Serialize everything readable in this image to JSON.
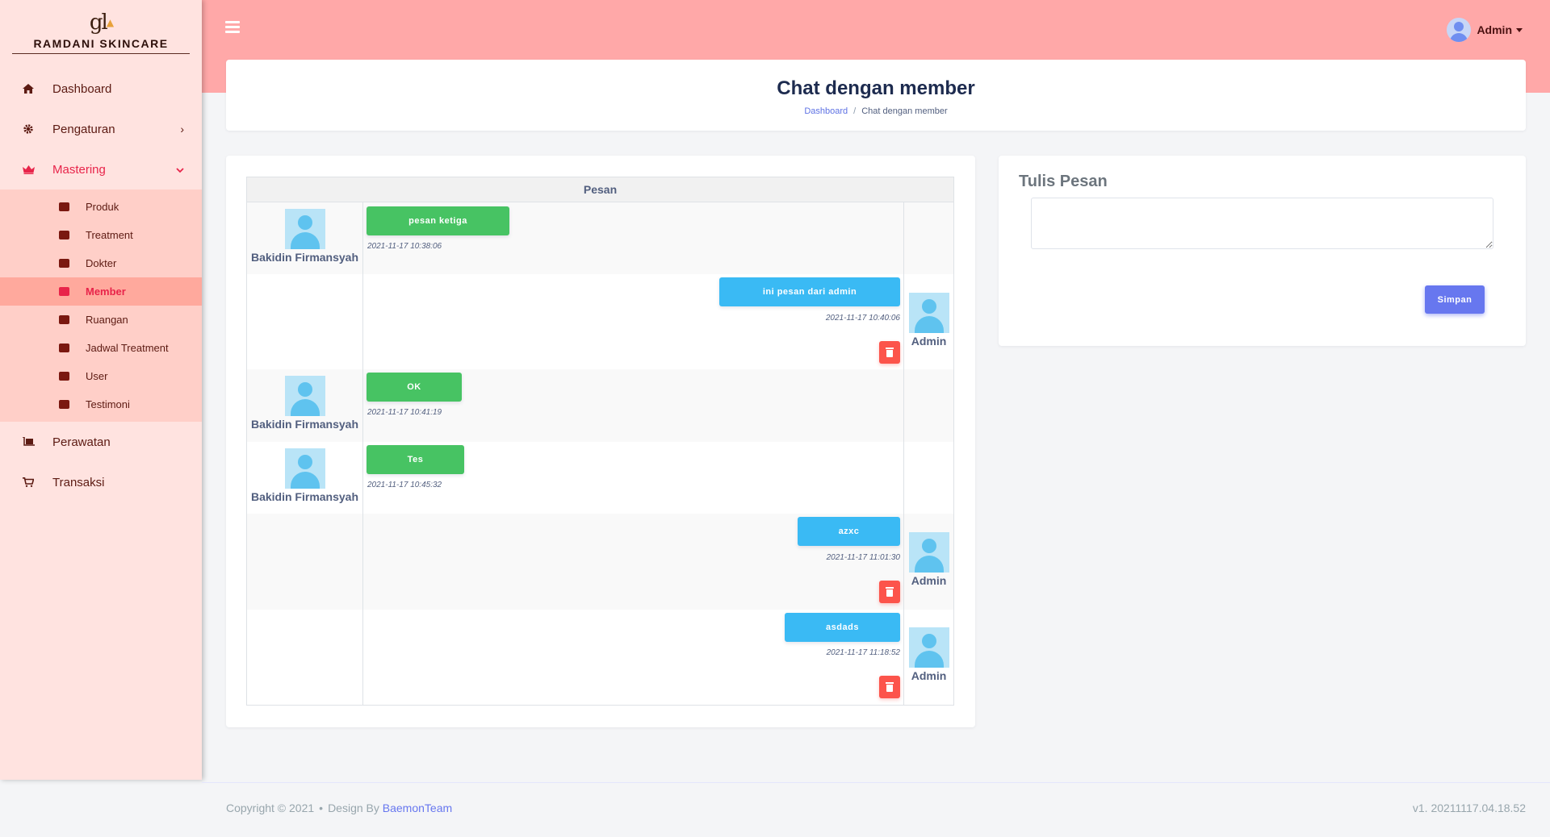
{
  "brand": {
    "logo_text": "gl",
    "name": "RAMDANI SKINCARE"
  },
  "header": {
    "user_name": "Admin"
  },
  "sidebar": {
    "items": [
      {
        "label": "Dashboard",
        "icon": "home-icon"
      },
      {
        "label": "Pengaturan",
        "icon": "cog-icon"
      },
      {
        "label": "Mastering",
        "icon": "crown-icon"
      },
      {
        "label": "Perawatan",
        "icon": "luggage-cart-icon"
      },
      {
        "label": "Transaksi",
        "icon": "cart-icon"
      }
    ],
    "submenu": [
      {
        "label": "Produk",
        "icon": "box-icon"
      },
      {
        "label": "Treatment",
        "icon": "spa-icon"
      },
      {
        "label": "Dokter",
        "icon": "doctor-icon"
      },
      {
        "label": "Member",
        "icon": "member-card-icon"
      },
      {
        "label": "Ruangan",
        "icon": "building-icon"
      },
      {
        "label": "Jadwal Treatment",
        "icon": "calendar-icon"
      },
      {
        "label": "User",
        "icon": "user-icon"
      },
      {
        "label": "Testimoni",
        "icon": "comments-icon"
      }
    ]
  },
  "page": {
    "title": "Chat dengan member",
    "breadcrumb": {
      "home": "Dashboard",
      "separator": "/",
      "current": "Chat dengan member"
    }
  },
  "chat": {
    "column_header": "Pesan",
    "messages": [
      {
        "sender": "Bakidin Firmansyah",
        "text": "pesan ketiga",
        "time": "2021-11-17 10:38:06"
      },
      {
        "sender": "Admin",
        "text": "ini pesan dari admin",
        "time": "2021-11-17 10:40:06"
      },
      {
        "sender": "Bakidin Firmansyah",
        "text": "OK",
        "time": "2021-11-17 10:41:19"
      },
      {
        "sender": "Bakidin Firmansyah",
        "text": "Tes",
        "time": "2021-11-17 10:45:32"
      },
      {
        "sender": "Admin",
        "text": "azxc",
        "time": "2021-11-17 11:01:30"
      },
      {
        "sender": "Admin",
        "text": "asdads",
        "time": "2021-11-17 11:18:52"
      }
    ]
  },
  "compose": {
    "title": "Tulis Pesan",
    "message_value": "",
    "save_label": "Simpan"
  },
  "footer": {
    "copyright": "Copyright © 2021",
    "bullet": "•",
    "design_by": "Design By",
    "team": "BaemonTeam",
    "version": "v1. 20211117.04.18.52"
  },
  "colors": {
    "header": "#ffa8a8",
    "sidebar": "#ffe3e0",
    "active": "#e8244a",
    "member_bubble": "#47c363",
    "admin_bubble": "#3abaf4",
    "delete": "#fc544b",
    "primary": "#6777ef"
  }
}
